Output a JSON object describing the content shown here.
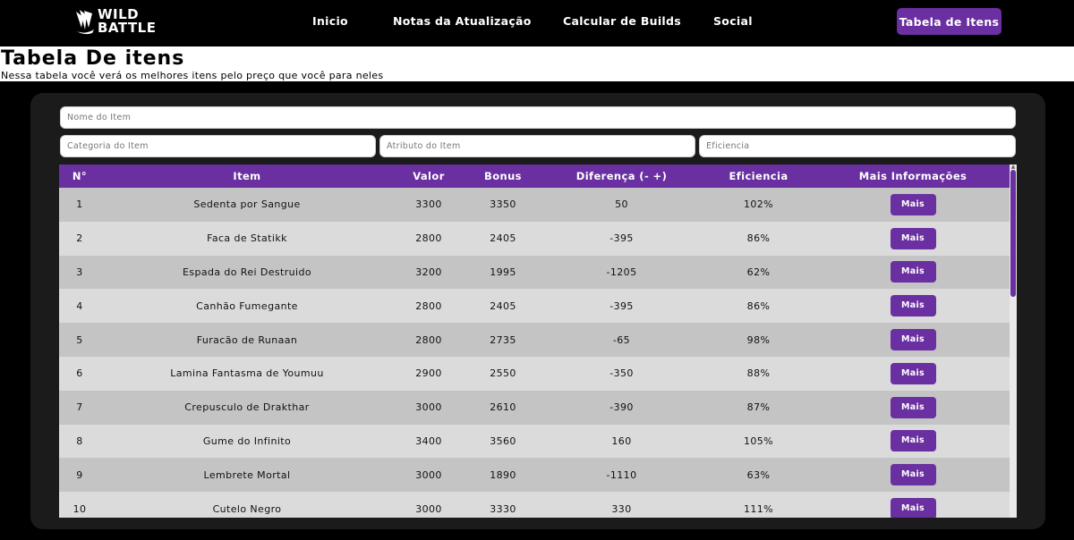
{
  "brand": {
    "line1": "WILD",
    "line2": "BATTLE",
    "icon": "claw-logo-icon"
  },
  "nav": {
    "links": [
      {
        "label": "Inicio"
      },
      {
        "label": "Notas da Atualização"
      },
      {
        "label": "Calcular de Builds"
      },
      {
        "label": "Social"
      }
    ],
    "active": "Tabela de Itens"
  },
  "header": {
    "title": "Tabela De itens",
    "subtitle": "Nessa tabela você verá os melhores itens pelo preço que você para neles"
  },
  "filters": {
    "name_placeholder": "Nome do Item",
    "category_placeholder": "Categoria do Item",
    "attribute_placeholder": "Atributo do Item",
    "efficiency_placeholder": "Eficiencia"
  },
  "table": {
    "columns": [
      "N°",
      "Item",
      "Valor",
      "Bonus",
      "Diferença (- +)",
      "Eficiencia",
      "Mais Informações"
    ],
    "button_label": "Mais",
    "rows": [
      {
        "n": "1",
        "item": "Sedenta por Sangue",
        "valor": "3300",
        "bonus": "3350",
        "diff": "50",
        "efic": "102%"
      },
      {
        "n": "2",
        "item": "Faca de Statikk",
        "valor": "2800",
        "bonus": "2405",
        "diff": "-395",
        "efic": "86%"
      },
      {
        "n": "3",
        "item": "Espada do Rei Destruido",
        "valor": "3200",
        "bonus": "1995",
        "diff": "-1205",
        "efic": "62%"
      },
      {
        "n": "4",
        "item": "Canhão Fumegante",
        "valor": "2800",
        "bonus": "2405",
        "diff": "-395",
        "efic": "86%"
      },
      {
        "n": "5",
        "item": "Furacão de Runaan",
        "valor": "2800",
        "bonus": "2735",
        "diff": "-65",
        "efic": "98%"
      },
      {
        "n": "6",
        "item": "Lamina Fantasma de Youmuu",
        "valor": "2900",
        "bonus": "2550",
        "diff": "-350",
        "efic": "88%"
      },
      {
        "n": "7",
        "item": "Crepusculo de Drakthar",
        "valor": "3000",
        "bonus": "2610",
        "diff": "-390",
        "efic": "87%"
      },
      {
        "n": "8",
        "item": "Gume do Infinito",
        "valor": "3400",
        "bonus": "3560",
        "diff": "160",
        "efic": "105%"
      },
      {
        "n": "9",
        "item": "Lembrete Mortal",
        "valor": "3000",
        "bonus": "1890",
        "diff": "-1110",
        "efic": "63%"
      },
      {
        "n": "10",
        "item": "Cutelo Negro",
        "valor": "3000",
        "bonus": "3330",
        "diff": "330",
        "efic": "111%"
      }
    ]
  },
  "colors": {
    "accent": "#6a2fa0",
    "panel": "#1b1b1b",
    "row_odd": "#c4c4c4",
    "row_even": "#dbdbdb"
  }
}
